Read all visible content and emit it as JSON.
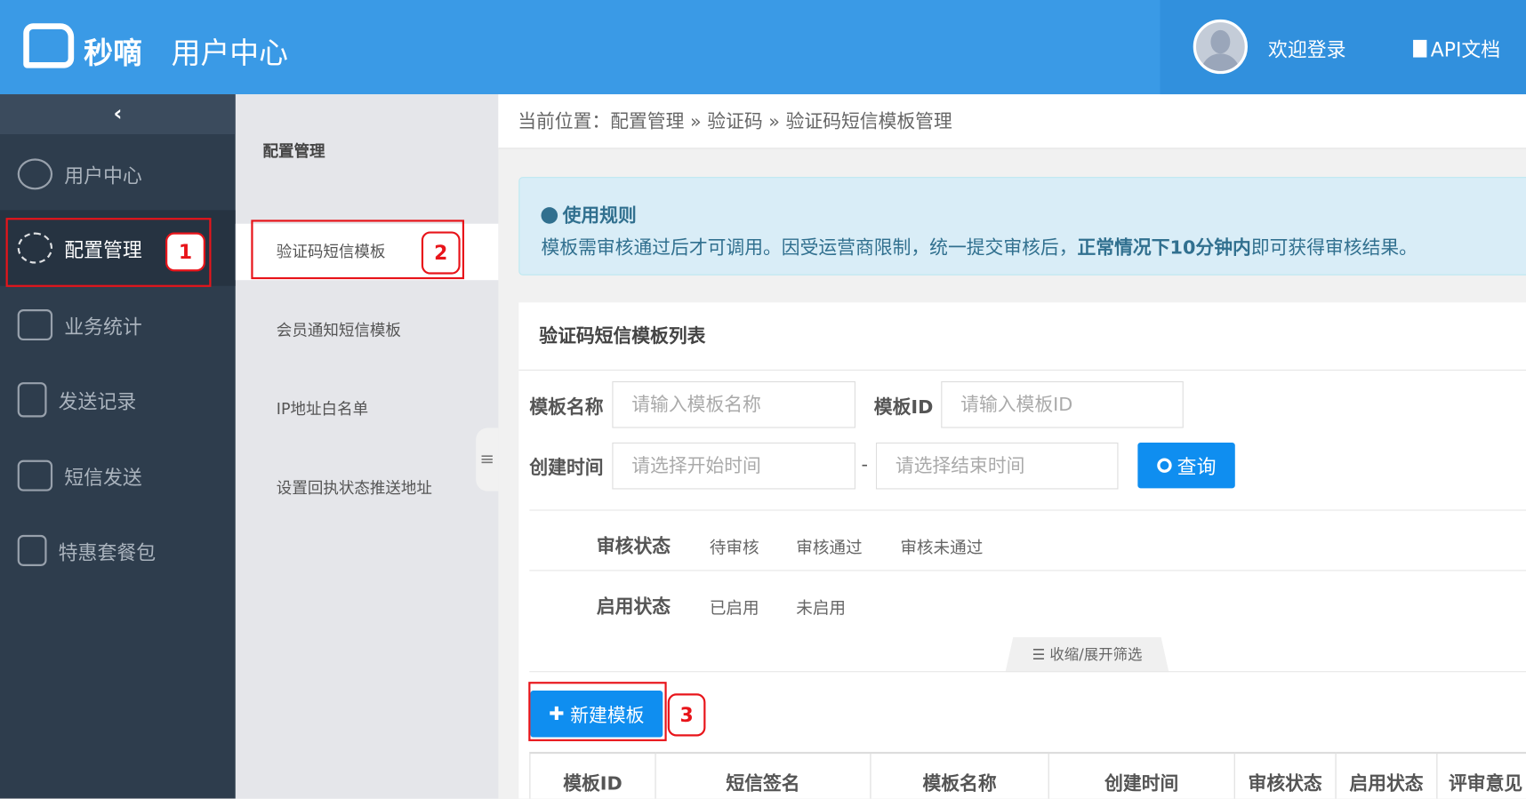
{
  "header": {
    "brand": "秒嘀",
    "title": "用户中心",
    "welcome": "欢迎登录",
    "api_docs": "API文档"
  },
  "sidebar": {
    "collapse": "‹",
    "items": [
      {
        "label": "用户中心"
      },
      {
        "label": "配置管理"
      },
      {
        "label": "业务统计"
      },
      {
        "label": "发送记录"
      },
      {
        "label": "短信发送"
      },
      {
        "label": "特惠套餐包"
      }
    ]
  },
  "submenu": {
    "title": "配置管理",
    "items": [
      {
        "label": "验证码短信模板"
      },
      {
        "label": "会员通知短信模板"
      },
      {
        "label": "IP地址白名单"
      },
      {
        "label": "设置回执状态推送地址"
      }
    ],
    "handle": "≡"
  },
  "breadcrumb": "当前位置：配置管理 » 验证码 » 验证码短信模板管理",
  "alert": {
    "title": "使用规则",
    "text_before": "模板需审核通过后才可调用。因受运营商限制，统一提交审核后，",
    "text_bold": "正常情况下10分钟内",
    "text_after": "即可获得审核结果。"
  },
  "card": {
    "title": "验证码短信模板列表",
    "form": {
      "name_label": "模板名称",
      "name_placeholder": "请输入模板名称",
      "id_label": "模板ID",
      "id_placeholder": "请输入模板ID",
      "time_label": "创建时间",
      "start_placeholder": "请选择开始时间",
      "dash": "-",
      "end_placeholder": "请选择结束时间",
      "query": "查询"
    },
    "filters": {
      "audit_label": "审核状态",
      "audit_options": [
        "待审核",
        "审核通过",
        "审核未通过"
      ],
      "enable_label": "启用状态",
      "enable_options": [
        "已启用",
        "未启用"
      ],
      "toggle": "☰ 收缩/展开筛选"
    },
    "new_button": "新建模板",
    "columns": [
      "模板ID",
      "短信签名",
      "模板名称",
      "创建时间",
      "审核状态",
      "启用状态",
      "评审意见"
    ]
  },
  "annotations": [
    "1",
    "2",
    "3"
  ]
}
